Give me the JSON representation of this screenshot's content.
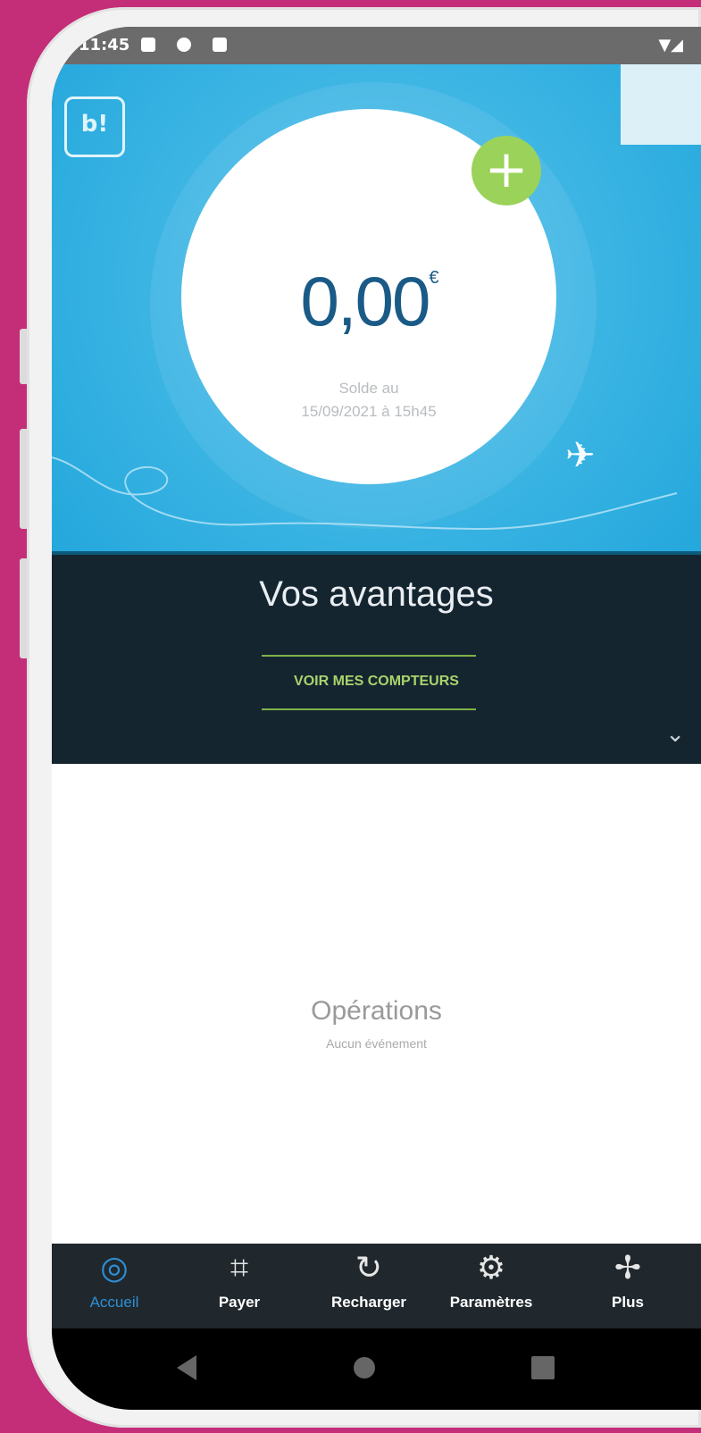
{
  "status_bar": {
    "time": "11:45",
    "signal": "▼◢"
  },
  "hero": {
    "logo_text": "b!",
    "balance": "0,00",
    "currency": "€",
    "as_of_line1": "Solde au",
    "as_of_line2": "15/09/2021 à 15h45",
    "plus_symbol": "+",
    "plane_glyph": "✈"
  },
  "advantages": {
    "title": "Vos avantages",
    "link": "VOIR MES COMPTEURS",
    "chevron": "⌄"
  },
  "operations": {
    "title": "Opérations",
    "subtitle": "Aucun événement"
  },
  "bottom_nav": {
    "items": [
      {
        "label": "Accueil",
        "icon": "◎"
      },
      {
        "label": "Payer",
        "icon": "⌗"
      },
      {
        "label": "Recharger",
        "icon": "↻"
      },
      {
        "label": "Paramètres",
        "icon": "⚙"
      },
      {
        "label": "Plus",
        "icon": "✢"
      }
    ]
  },
  "colors": {
    "background": "#c42d78",
    "hero_blue": "#3ab4e3",
    "dark_panel": "#152530",
    "accent_green": "#9bd25a",
    "active_nav": "#2f8fd6"
  }
}
